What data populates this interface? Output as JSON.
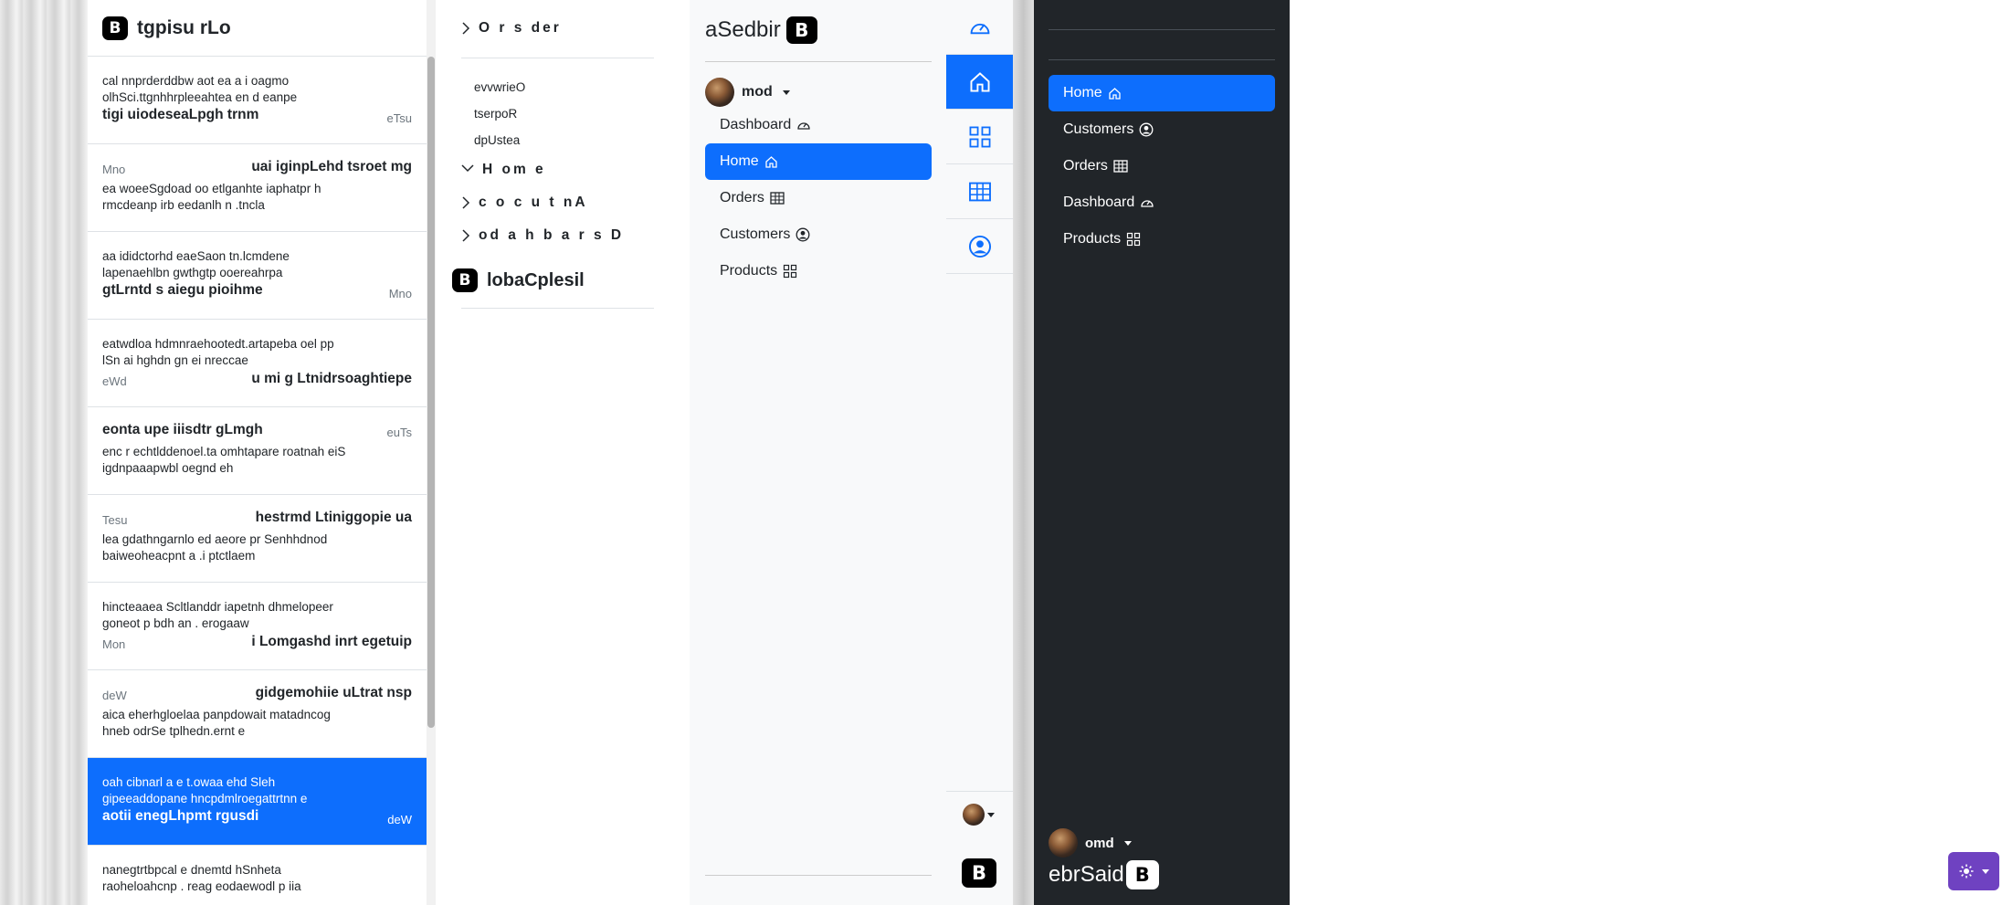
{
  "list_panel": {
    "title": "tgpisu rLo",
    "items": [
      {
        "title": "tigi uiodeseaLpgh trnm",
        "text1": "cal nnprderddbw aot ea a i oagmo",
        "text2": "olhSci.ttgnhhrpleeahtea en d eanpe",
        "day": "eTsu"
      },
      {
        "title": "uai iginpLehd tsroet mg",
        "text1": "ea woeeSgdoad oo etlganhte iaphatpr h",
        "text2": "rmcdeanp irb eedanlh n .tncla",
        "day": "Mno"
      },
      {
        "title": "gtLrntd s aiegu pioihme",
        "text1": "aa ididctorhd eaeSaon tn.lcmdene",
        "text2": "lapenaehlbn gwthgtp ooereahrpa",
        "day": "Mno"
      },
      {
        "title": "u mi g Ltnidrsoaghtiepe",
        "text1": "eatwdloa hdmnraehootedt.artapeba oel pp",
        "text2": "lSn ai hghdn gn ei nreccae",
        "day": "eWd"
      },
      {
        "title": "eonta upe iiisdtr gLmgh",
        "text1": "enc r echtlddenoel.ta omhtapare roatnah eiS",
        "text2": "igdnpaaapwbl oegnd eh",
        "day": "euTs"
      },
      {
        "title": "hestrmd Ltiniggopie ua",
        "text1": "lea gdathngarnlo ed aeore pr Senhhdnod",
        "text2": "baiweoheacpnt a .i ptctlaem",
        "day": "Tesu"
      },
      {
        "title": "i Lomgashd inrt egetuip",
        "text1": "hincteaaea Scltlanddr iapetnh dhmelopeer",
        "text2": "goneot p bdh an . erogaaw",
        "day": "Mon"
      },
      {
        "title": "gidgemohiie uLtrat nsp",
        "text1": "aica eherhgloelaa panpdowait matadncog",
        "text2": "hneb odrSe tplhedn.ernt e",
        "day": "deW"
      },
      {
        "title": "aotii enegLhpmt rgusdi",
        "text1": "oah cibnarl a e t.owaa ehd Sleh",
        "text2": "gipeeaddopane hncpdmlroegattrtnn e",
        "day": "deW"
      },
      {
        "title": "",
        "text1": "nanegtrtbpcal e dnemtd hSnheta",
        "text2": "raoheloahcnp . reag eodaewodl p iia",
        "day": ""
      }
    ]
  },
  "collapse_panel": {
    "orders_label": "O r s der",
    "sub_items": [
      "evvwrieO",
      "tserpoR",
      "dpUstea"
    ],
    "home_label": "H om e",
    "account_label": "c o c u t nA",
    "dashboard_label": "od a h b a r s D",
    "brand_title": "lobaCplesil"
  },
  "light_sidebar": {
    "brand": "aSedbir",
    "bs_letter": "B",
    "user": "mod",
    "nav": [
      {
        "label": "Dashboard",
        "icon": "speedometer-icon"
      },
      {
        "label": "Home",
        "icon": "house-icon",
        "active": true
      },
      {
        "label": "Orders",
        "icon": "table-icon"
      },
      {
        "label": "Customers",
        "icon": "person-circle-icon"
      },
      {
        "label": "Products",
        "icon": "grid-icon"
      }
    ]
  },
  "icon_rail": {
    "icons": [
      "speedometer-icon",
      "house-icon",
      "grid-icon",
      "table-icon",
      "person-circle-icon"
    ],
    "active_index": 1,
    "bs_letter": "B"
  },
  "dark_sidebar": {
    "nav": [
      {
        "label": "Home",
        "icon": "house-icon",
        "active": true
      },
      {
        "label": "Customers",
        "icon": "person-circle-icon"
      },
      {
        "label": "Orders",
        "icon": "table-icon"
      },
      {
        "label": "Dashboard",
        "icon": "speedometer-icon"
      },
      {
        "label": "Products",
        "icon": "grid-icon"
      }
    ],
    "user": "omd",
    "brand": "ebrSaid",
    "bs_letter": "B"
  },
  "list_panel_logo": "B",
  "collapse_brand_logo": "B",
  "theme_toggle": {
    "icon": "sun-icon",
    "color": "#6f42c1"
  },
  "colors": {
    "primary": "#0d6efd",
    "dark": "#212529",
    "light": "#f8f9fa"
  }
}
